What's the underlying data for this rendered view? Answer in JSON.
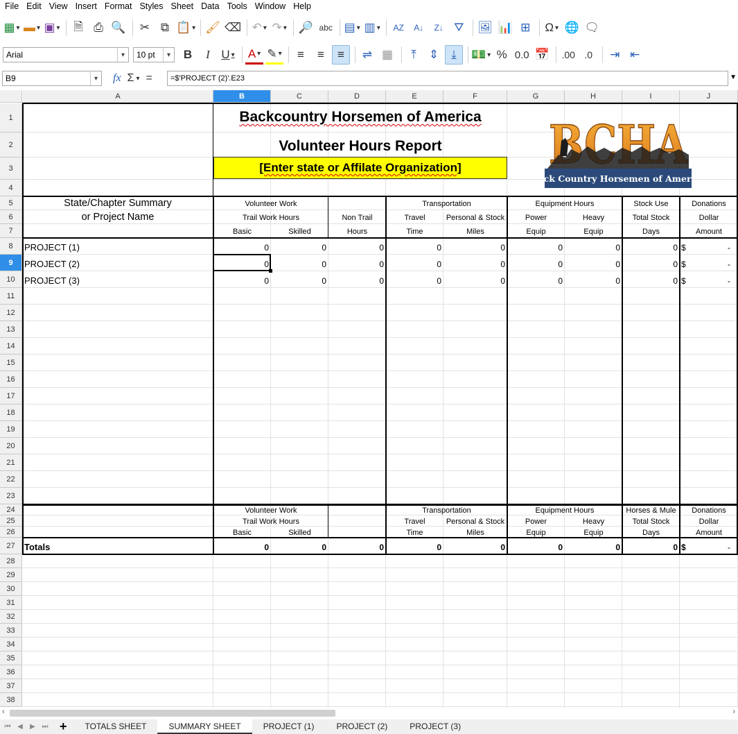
{
  "menu": [
    "File",
    "Edit",
    "View",
    "Insert",
    "Format",
    "Styles",
    "Sheet",
    "Data",
    "Tools",
    "Window",
    "Help"
  ],
  "toolbar": {
    "font_name": "Arial",
    "font_size": "10 pt",
    "bold": "B",
    "italic": "I",
    "underline": "U",
    "percent": "%",
    "number_format": "0.0",
    "add_decimal": ".00",
    "del_decimal": ".0"
  },
  "formula_bar": {
    "name_box": "B9",
    "formula": "=$'PROJECT (2)'.E23",
    "sigma": "Σ",
    "equals": "="
  },
  "columns": [
    "A",
    "B",
    "C",
    "D",
    "E",
    "F",
    "G",
    "H",
    "I",
    "J"
  ],
  "rows": [
    "1",
    "2",
    "3",
    "4",
    "5",
    "6",
    "7",
    "8",
    "9",
    "10",
    "11",
    "12",
    "13",
    "14",
    "15",
    "16",
    "17",
    "18",
    "19",
    "20",
    "21",
    "22",
    "23",
    "24",
    "25",
    "26",
    "27",
    "28",
    "29",
    "30",
    "31",
    "32",
    "33",
    "34",
    "35",
    "36",
    "37",
    "38"
  ],
  "sheet": {
    "title1": "Backcountry Horsemen of America",
    "title2": "Volunteer Hours Report",
    "title3": "[Enter state or Affilate Organization]",
    "logo_text": "Back Country Horsemen of America",
    "summary_label_1": "State/Chapter Summary",
    "summary_label_2": "or Project Name",
    "header_row5": [
      "Volunteer Work",
      "Transportation",
      "Equipment Hours",
      "Stock Use",
      "Donations"
    ],
    "header_row6": [
      "Trail Work Hours",
      "Non Trail",
      "Travel",
      "Personal & Stock",
      "Power",
      "Heavy",
      "Total Stock",
      "Dollar"
    ],
    "header_row7": [
      "Basic",
      "Skilled",
      "Hours",
      "Time",
      "Miles",
      "Equip",
      "Equip",
      "Days",
      "Amount"
    ],
    "projects": [
      {
        "name": "PROJECT (1)",
        "values": [
          "0",
          "0",
          "0",
          "0",
          "0",
          "0",
          "0",
          "0"
        ],
        "dollar": "$",
        "amount": "-"
      },
      {
        "name": "PROJECT (2)",
        "values": [
          "0",
          "0",
          "0",
          "0",
          "0",
          "0",
          "0",
          "0"
        ],
        "dollar": "$",
        "amount": "-"
      },
      {
        "name": "PROJECT (3)",
        "values": [
          "0",
          "0",
          "0",
          "0",
          "0",
          "0",
          "0",
          "0"
        ],
        "dollar": "$",
        "amount": "-"
      }
    ],
    "header_row24": [
      "Volunteer Work",
      "Transportation",
      "Equipment Hours",
      "Horses & Mule",
      "Donations"
    ],
    "header_row25": [
      "Trail Work Hours",
      "Travel",
      "Personal & Stock",
      "Power",
      "Heavy",
      "Total Stock",
      "Dollar"
    ],
    "header_row26": [
      "Basic",
      "Skilled",
      "Time",
      "Miles",
      "Equip",
      "Equip",
      "Days",
      "Amount"
    ],
    "totals": {
      "label": "Totals",
      "values": [
        "0",
        "0",
        "0",
        "0",
        "0",
        "0",
        "0",
        "0"
      ],
      "dollar": "$",
      "amount": "-"
    }
  },
  "tabs": [
    "TOTALS SHEET",
    "SUMMARY SHEET",
    "PROJECT (1)",
    "PROJECT (2)",
    "PROJECT (3)"
  ],
  "active_tab": "SUMMARY SHEET",
  "colors": {
    "selection": "#2f8ee8",
    "highlight_yellow": "#ffff00",
    "logo_orange": "#f0961e",
    "logo_blue": "#2b4a7a"
  }
}
